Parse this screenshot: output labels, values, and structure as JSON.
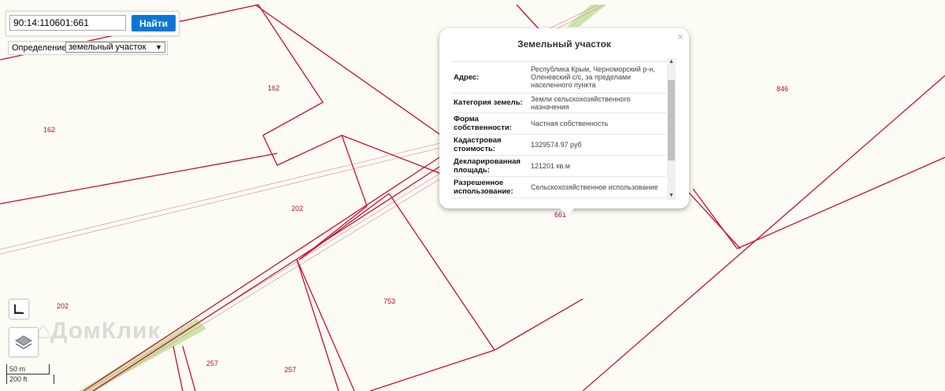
{
  "search": {
    "value": "90:14:110601:661",
    "button_label": "Найти"
  },
  "definition": {
    "label": "Определение:",
    "selected": "земельный участок"
  },
  "popup": {
    "title": "Земельный участок",
    "close": "×",
    "rows": [
      {
        "label": "Адрес:",
        "value": "Республика Крым, Черноморский р-н, Оленевский с/с, за пределами населенного пункта"
      },
      {
        "label": "Категория земель:",
        "value": "Земли сельскохозяйственного назначения"
      },
      {
        "label": "Форма собственности:",
        "value": "Частная собственность"
      },
      {
        "label": "Кадастровая стоимость:",
        "value": "1329574.97 руб"
      },
      {
        "label": "Декларированная площадь:",
        "value": "121201 кв.м"
      },
      {
        "label": "Разрешенное использование:",
        "value": "Сельскохозяйственное использование"
      }
    ]
  },
  "parcel_labels": [
    "162",
    "162",
    "202",
    "202",
    "753",
    "257",
    "257",
    "846",
    "661"
  ],
  "scale": {
    "metric": "50 m",
    "imperial": "200 ft"
  },
  "watermark": "ДомКлик",
  "colors": {
    "boundary": "#c8102e",
    "road_green": "#c8e6a8",
    "accent": "#0a77d4"
  }
}
